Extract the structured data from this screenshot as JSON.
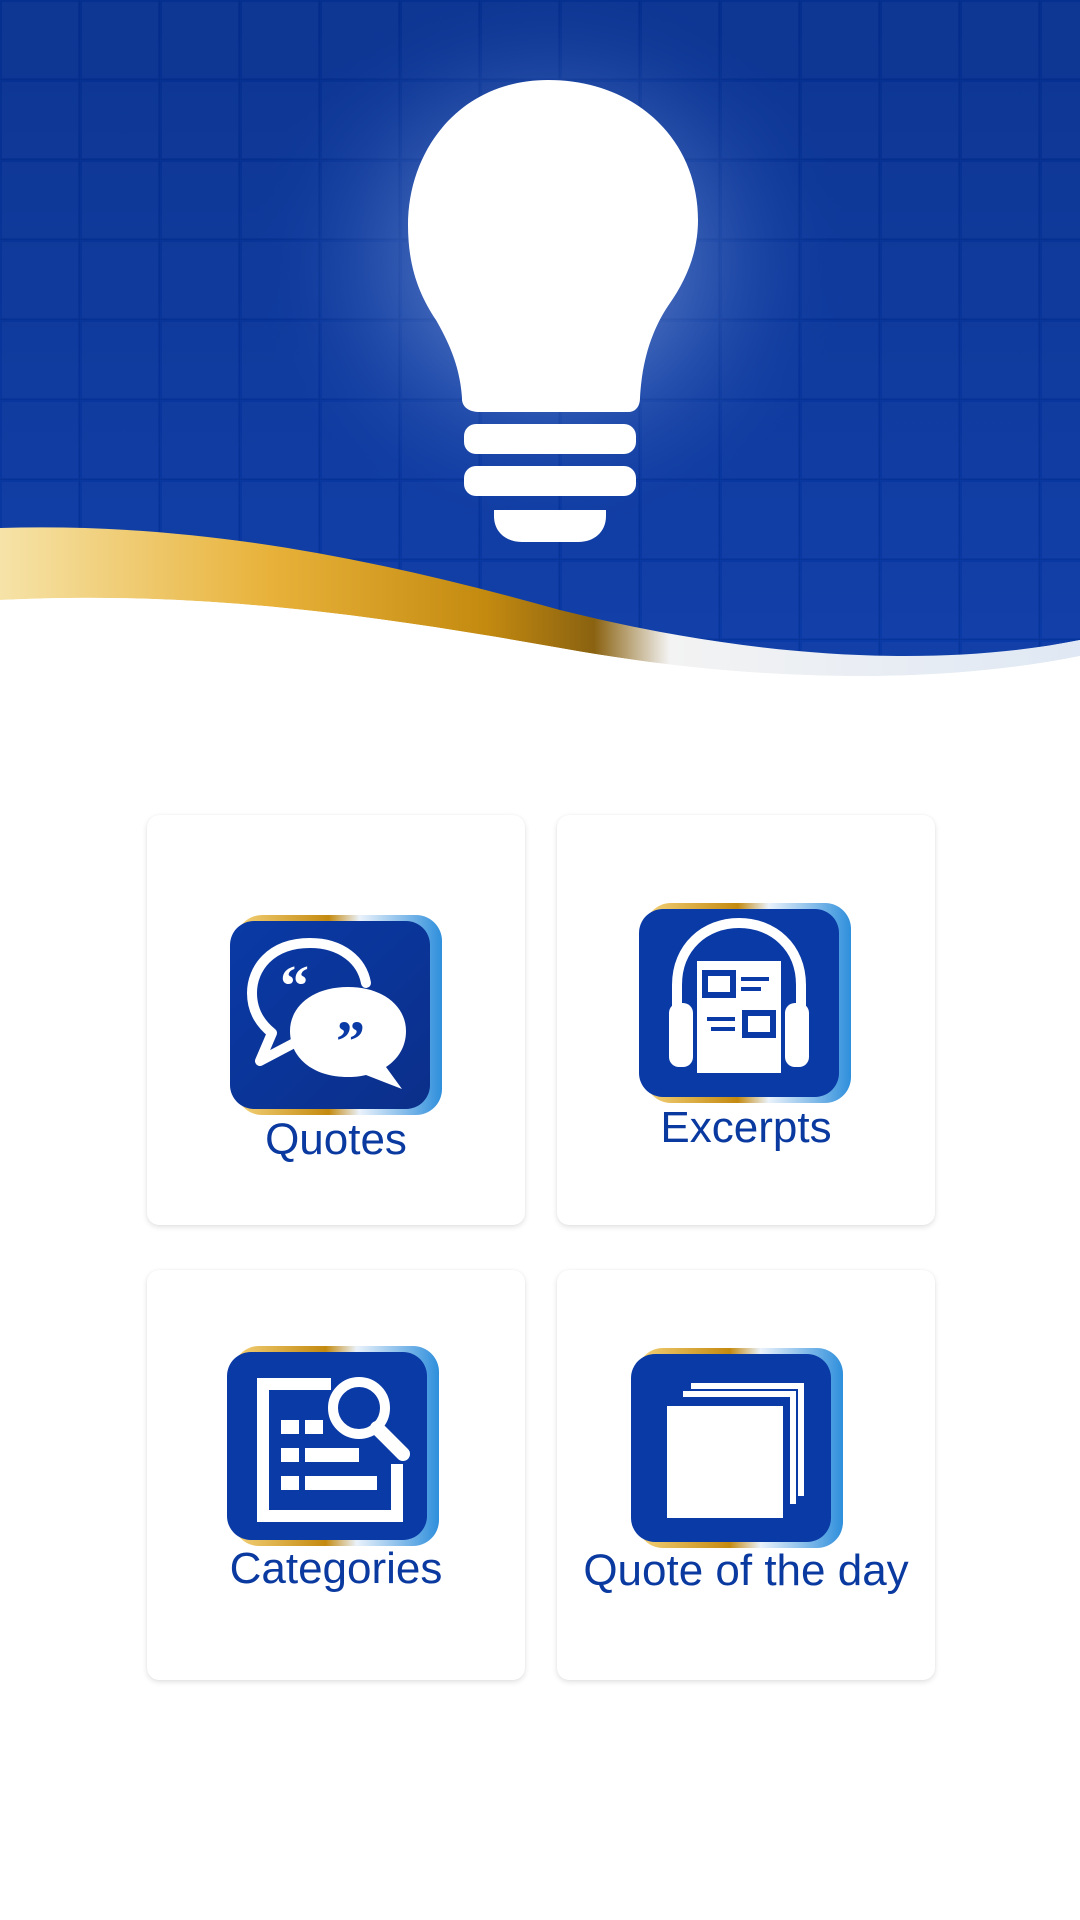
{
  "colors": {
    "brand_blue": "#0a3aa0",
    "hero_blue": "#06308f",
    "gold": "#d99a12",
    "light_blue": "#3d9be0"
  },
  "hero": {
    "icon": "lightbulb-icon"
  },
  "menu": [
    {
      "id": "quotes",
      "label": "Quotes",
      "icon": "speech-bubbles-quote-icon"
    },
    {
      "id": "excerpts",
      "label": "Excerpts",
      "icon": "headphones-book-icon"
    },
    {
      "id": "categories",
      "label": "Categories",
      "icon": "document-search-icon"
    },
    {
      "id": "quote_of_the_day",
      "label": "Quote of the day",
      "icon": "stacked-cards-icon"
    }
  ]
}
